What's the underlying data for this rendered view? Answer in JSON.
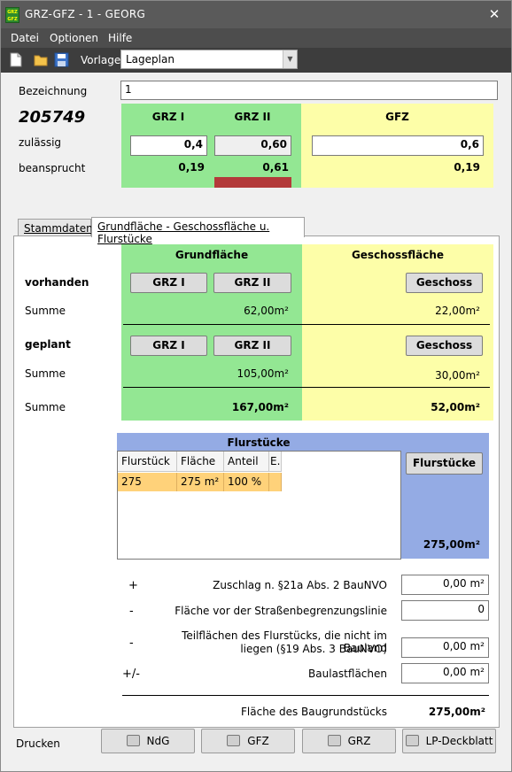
{
  "window": {
    "title": "GRZ-GFZ  -  1 -   GEORG",
    "icon_text": "GRZ GFZ"
  },
  "menu": {
    "datei": "Datei",
    "optionen": "Optionen",
    "hilfe": "Hilfe"
  },
  "toolbar": {
    "vorlage_label": "Vorlage",
    "vorlage_value": "Lageplan"
  },
  "header": {
    "bezeichnung_label": "Bezeichnung",
    "bezeichnung_value": "1",
    "number": "205749",
    "zulaessig_label": "zulässig",
    "beansprucht_label": "beansprucht",
    "grz1": {
      "title": "GRZ I",
      "zulaessig": "0,4",
      "beansprucht": "0,19"
    },
    "grz2": {
      "title": "GRZ II",
      "zulaessig": "0,60",
      "beansprucht": "0,61"
    },
    "gfz": {
      "title": "GFZ",
      "zulaessig": "0,6",
      "beansprucht": "0,19"
    },
    "warn_color": "#b33a3a"
  },
  "tabs": {
    "stammdaten": "Stammdaten",
    "grundflaeche": "Grundfläche - Geschossfläche u. Flurstücke"
  },
  "main": {
    "grundflaeche_header": "Grundfläche",
    "geschossflaeche_header": "Geschossfläche",
    "vorhanden_label": "vorhanden",
    "geplant_label": "geplant",
    "summe_label": "Summe",
    "btn_grz1": "GRZ I",
    "btn_grz2": "GRZ II",
    "btn_geschoss": "Geschoss",
    "vorhanden_grund": "62,00m²",
    "vorhanden_geschoss": "22,00m²",
    "geplant_grund": "105,00m²",
    "geplant_geschoss": "30,00m²",
    "total_grund": "167,00m²",
    "total_geschoss": "52,00m²"
  },
  "flurstuecke": {
    "title": "Flurstücke",
    "button": "Flurstücke",
    "total": "275,00m²",
    "columns": [
      "Flurstück",
      "Fläche",
      "Anteil",
      "E."
    ],
    "rows": [
      {
        "flurstueck": "275",
        "flaeche": "275 m²",
        "anteil": "100 %"
      }
    ]
  },
  "adjust": {
    "zuschlag_sign": "+",
    "zuschlag_label": "Zuschlag n. §21a Abs. 2 BauNVO",
    "zuschlag_value": "0,00 m²",
    "strasse_sign": "-",
    "strasse_label": "Fläche vor der Straßenbegrenzungslinie",
    "strasse_value": "0",
    "teil_sign": "-",
    "teil_label_1": "Teilflächen des Flurstücks, die nicht im Bauland",
    "teil_label_2": "liegen (§19 Abs. 3 BauNVO)",
    "teil_value": "0,00 m²",
    "baulast_sign": "+/-",
    "baulast_label": "Baulastflächen",
    "baulast_value": "0,00 m²",
    "baugrund_label": "Fläche des Baugrundstücks",
    "baugrund_value": "275,00m²"
  },
  "bottom": {
    "drucken_label": "Drucken",
    "ndg": "NdG",
    "gfz": "GFZ",
    "grz": "GRZ",
    "lp": "LP-Deckblatt"
  }
}
